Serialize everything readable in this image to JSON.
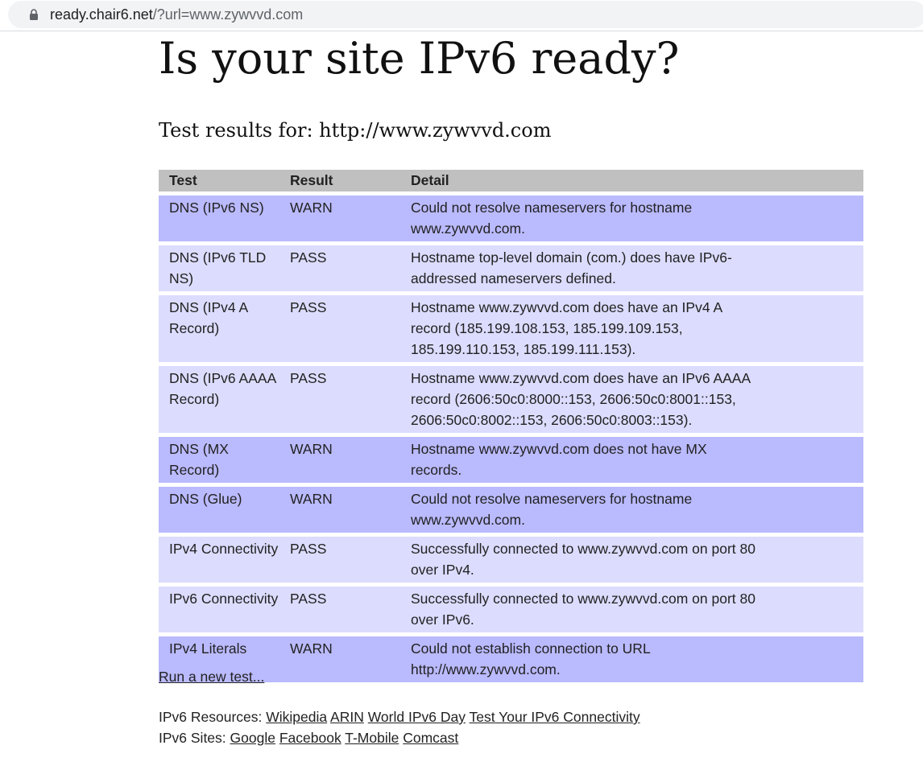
{
  "browser": {
    "url_host": "ready.chair6.net",
    "url_path": "/?url=www.zywvvd.com",
    "lock_icon": "lock-icon"
  },
  "page": {
    "title": "Is your site IPv6 ready?",
    "subtitle": "Test results for: http://www.zywvvd.com"
  },
  "table": {
    "headers": [
      "Test",
      "Result",
      "Detail"
    ],
    "rows": [
      {
        "test": "DNS (IPv6 NS)",
        "result": "WARN",
        "detail": "Could not resolve nameservers for hostname www.zywvvd.com."
      },
      {
        "test": "DNS (IPv6 TLD NS)",
        "result": "PASS",
        "detail": "Hostname top-level domain (com.) does have IPv6-addressed nameservers defined."
      },
      {
        "test": "DNS (IPv4 A Record)",
        "result": "PASS",
        "detail": "Hostname www.zywvvd.com does have an IPv4 A record (185.199.108.153, 185.199.109.153, 185.199.110.153, 185.199.111.153)."
      },
      {
        "test": "DNS (IPv6 AAAA Record)",
        "result": "PASS",
        "detail": "Hostname www.zywvvd.com does have an IPv6 AAAA record (2606:50c0:8000::153, 2606:50c0:8001::153, 2606:50c0:8002::153, 2606:50c0:8003::153)."
      },
      {
        "test": "DNS (MX Record)",
        "result": "WARN",
        "detail": "Hostname www.zywvvd.com does not have MX records."
      },
      {
        "test": "DNS (Glue)",
        "result": "WARN",
        "detail": "Could not resolve nameservers for hostname www.zywvvd.com."
      },
      {
        "test": "IPv4 Connectivity",
        "result": "PASS",
        "detail": "Successfully connected to www.zywvvd.com on port 80 over IPv4."
      },
      {
        "test": "IPv6 Connectivity",
        "result": "PASS",
        "detail": "Successfully connected to www.zywvvd.com on port 80 over IPv6."
      },
      {
        "test": "IPv4 Literals",
        "result": "WARN",
        "detail": "Could not establish connection to URL http://www.zywvvd.com."
      }
    ]
  },
  "colors": {
    "warn_row": "#babaff",
    "pass_row": "#dcdcff",
    "header_row": "#c0c0c0"
  },
  "links": {
    "run_new_test": "Run a new test..."
  },
  "footer": {
    "resources_label": "IPv6 Resources:",
    "resources": [
      "Wikipedia",
      "ARIN",
      "World IPv6 Day",
      "Test Your IPv6 Connectivity"
    ],
    "sites_label": "IPv6 Sites:",
    "sites": [
      "Google",
      "Facebook",
      "T-Mobile",
      "Comcast"
    ]
  }
}
